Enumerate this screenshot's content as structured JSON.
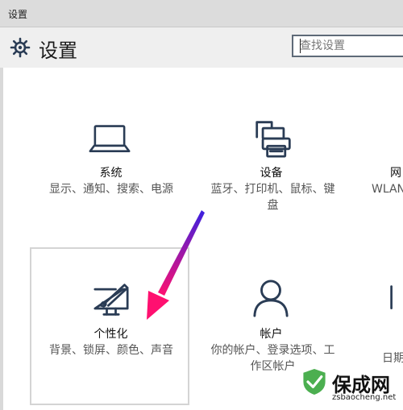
{
  "window": {
    "title": "设置"
  },
  "header": {
    "title": "设置",
    "search_placeholder": "查找设置"
  },
  "tiles": {
    "system": {
      "name": "系统",
      "desc": "显示、通知、搜索、电源"
    },
    "devices": {
      "name": "设备",
      "desc": "蓝牙、打印机、鼠标、键盘"
    },
    "network": {
      "name": "网",
      "desc": "WLAN"
    },
    "personalization": {
      "name": "个性化",
      "desc": "背景、锁屏、颜色、声音"
    },
    "accounts": {
      "name": "帐户",
      "desc": "你的帐户、登录选项、工作区帐户"
    },
    "time": {
      "desc": "日期"
    }
  },
  "watermark": {
    "brand": "保成网",
    "url": "zsbaocheng.net"
  },
  "colors": {
    "accent": "#2a3c55",
    "arrow_start": "#3a20e0",
    "arrow_end": "#ff1070"
  }
}
